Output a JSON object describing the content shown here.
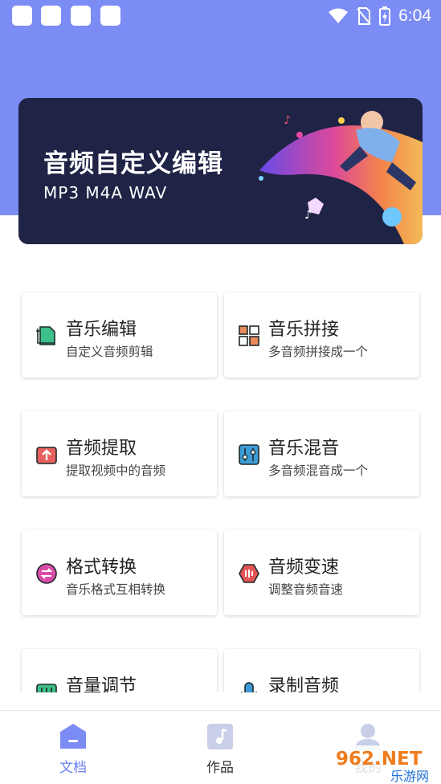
{
  "status_bar": {
    "time": "6:04",
    "icons": [
      "app-icon",
      "app-icon",
      "app-icon",
      "app-icon",
      "wifi-icon",
      "no-sim-icon",
      "battery-charging-icon"
    ]
  },
  "banner": {
    "title": "音频自定义编辑",
    "formats": "MP3   M4A   WAV"
  },
  "features": [
    {
      "title": "音乐编辑",
      "subtitle": "自定义音频剪辑",
      "icon": "music-edit-icon",
      "color": "#3dbf8a"
    },
    {
      "title": "音乐拼接",
      "subtitle": "多音频拼接成一个",
      "icon": "music-join-icon",
      "color": "#e98a5b"
    },
    {
      "title": "音频提取",
      "subtitle": "提取视频中的音频",
      "icon": "audio-extract-icon",
      "color": "#e8605e"
    },
    {
      "title": "音乐混音",
      "subtitle": "多音频混音成一个",
      "icon": "music-mix-icon",
      "color": "#3c9bd6"
    },
    {
      "title": "格式转换",
      "subtitle": "音乐格式互相转换",
      "icon": "format-convert-icon",
      "color": "#d94ca8"
    },
    {
      "title": "音频变速",
      "subtitle": "调整音频音速",
      "icon": "audio-speed-icon",
      "color": "#e25555"
    },
    {
      "title": "音量调节",
      "subtitle": "",
      "icon": "volume-adjust-icon",
      "color": "#3dbf8a"
    },
    {
      "title": "录制音频",
      "subtitle": "",
      "icon": "record-audio-icon",
      "color": "#3c9bd6"
    }
  ],
  "nav": {
    "items": [
      {
        "label": "文档",
        "icon": "document-icon",
        "active": true
      },
      {
        "label": "作品",
        "icon": "music-note-icon",
        "active": false
      },
      {
        "label": "我的",
        "icon": "user-icon",
        "active": false
      }
    ]
  },
  "watermark": {
    "brand": "962.NET",
    "name": "乐游网"
  },
  "colors": {
    "header_bg": "#7b8cf5",
    "banner_bg": "#1f2346",
    "active_tab": "#6b7ff0"
  }
}
